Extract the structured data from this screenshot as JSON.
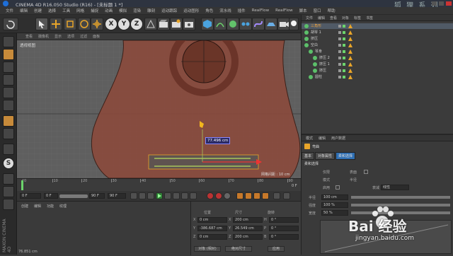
{
  "window": {
    "title": "CINEMA 4D R16.050 Studio (R16) - [未标题 1 *]"
  },
  "watermark_tr": "狐 狸 系 列",
  "menu": [
    "文件",
    "编辑",
    "创建",
    "选择",
    "工具",
    "网格",
    "捕捉",
    "动画",
    "模拟",
    "渲染",
    "雕刻",
    "运动跟踪",
    "运动图形",
    "角色",
    "流水线",
    "插件",
    "RealFlow",
    "RealFlow",
    "脚本",
    "窗口",
    "帮助"
  ],
  "toolbar": {
    "x_label": "X",
    "y_label": "Y",
    "z_label": "Z"
  },
  "viewport": {
    "menu": [
      "查看",
      "摄像机",
      "显示",
      "选项",
      "过滤",
      "面板"
    ],
    "label": "透视视图",
    "measure": "77.496 cm",
    "grid_spacing": "网格间距 : 10 cm"
  },
  "timeline": {
    "ticks": [
      "0",
      "10",
      "20",
      "30",
      "40",
      "50",
      "60",
      "70",
      "80",
      "90"
    ],
    "frame": "0 F"
  },
  "playbar": {
    "start": "0 F",
    "current": "0 F",
    "end": "90 F",
    "max": "90 F"
  },
  "materials": {
    "menu": [
      "创建",
      "编辑",
      "功能",
      "纹理"
    ]
  },
  "coords": {
    "headers": [
      "位置",
      "尺寸",
      "旋转"
    ],
    "rows": [
      {
        "axis": "X",
        "pos": "0 cm",
        "size": "200 cm",
        "rot_axis": "H",
        "rot": "0 °"
      },
      {
        "axis": "Y",
        "pos": "-386.687 cm",
        "size": "26.549 cm",
        "rot_axis": "P",
        "rot": "0 °"
      },
      {
        "axis": "Z",
        "pos": "0 cm",
        "size": "200 cm",
        "rot_axis": "B",
        "rot": "0 °"
      }
    ],
    "mode1": "对象 (相对)",
    "mode2": "绝对尺寸",
    "apply": "应用"
  },
  "status": "76.851 cm",
  "brand": "MAXON CINEMA 4D",
  "objects": {
    "tabs": [
      "文件",
      "编辑",
      "查看",
      "对象",
      "标签",
      "书签"
    ],
    "items": [
      {
        "name": "三角形",
        "indent": 0,
        "selected": true
      },
      {
        "name": "胡琴 1",
        "indent": 0,
        "selected": false
      },
      {
        "name": "挤压",
        "indent": 0,
        "selected": false
      },
      {
        "name": "空白",
        "indent": 0,
        "selected": false
      },
      {
        "name": "琴身",
        "indent": 1,
        "selected": false
      },
      {
        "name": "挤压 2",
        "indent": 2,
        "selected": false
      },
      {
        "name": "挤压 1",
        "indent": 2,
        "selected": false
      },
      {
        "name": "挤压",
        "indent": 2,
        "selected": false
      },
      {
        "name": "圆柱",
        "indent": 1,
        "selected": false
      }
    ]
  },
  "attrs": {
    "tabs": [
      "模式",
      "编辑",
      "用户数据"
    ],
    "object_label": "弯曲",
    "subtabs": [
      "基本",
      "对象属性",
      "柔和选择"
    ],
    "section": "柔和选择",
    "r1a": "仅限",
    "r1b": "表面",
    "r2a": "模式",
    "r2b": "半径",
    "r3": "启用",
    "falloff_label": "衰减",
    "falloff_val": "线性",
    "rows": [
      {
        "label": "半径",
        "val": "100 cm"
      },
      {
        "label": "强度",
        "val": "100 %"
      },
      {
        "label": "宽度",
        "val": "50 %"
      }
    ]
  },
  "site": {
    "name": "Bai 经验",
    "url": "jingyan.baidu.com"
  }
}
